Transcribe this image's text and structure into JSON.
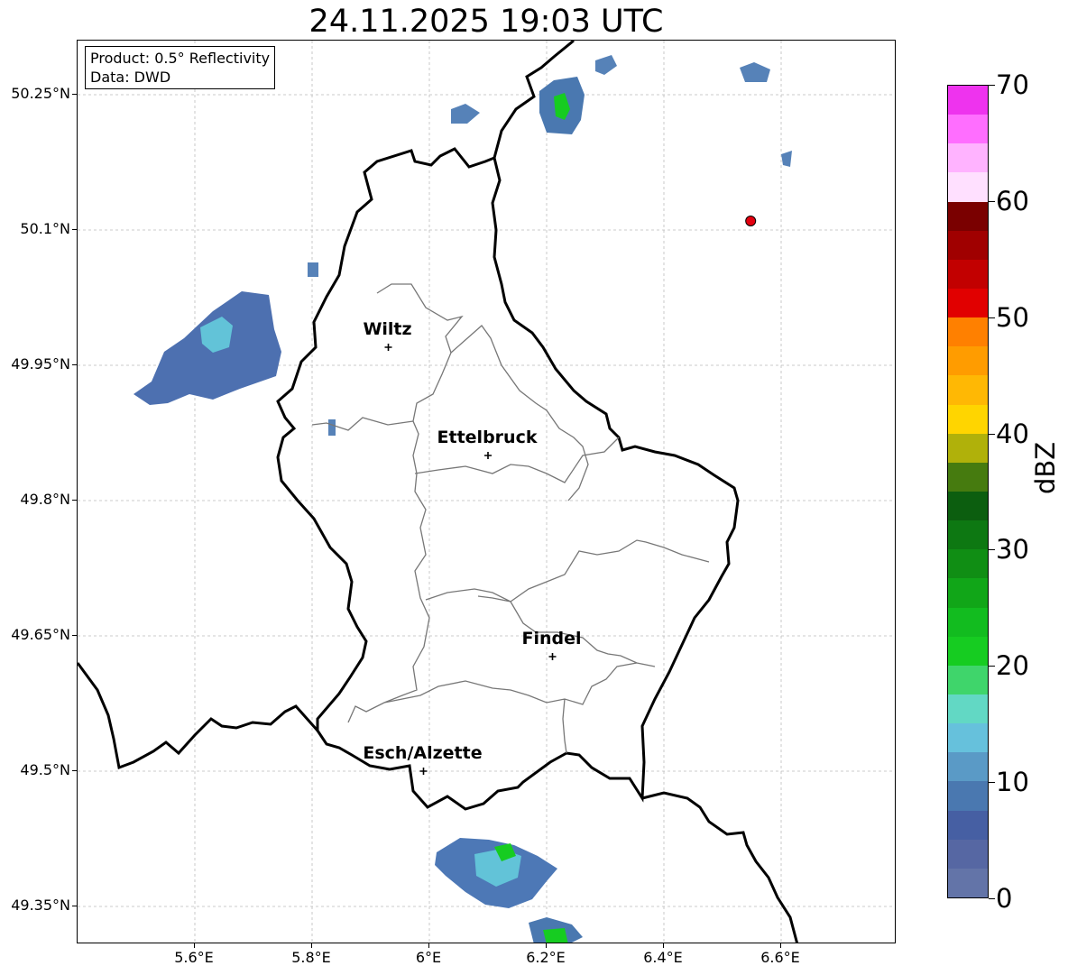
{
  "title": "24.11.2025 19:03 UTC",
  "info": {
    "line1": "Product: 0.5° Reflectivity",
    "line2": "Data: DWD"
  },
  "axes": {
    "lat_labels": [
      "50.25°N",
      "50.1°N",
      "49.95°N",
      "49.8°N",
      "49.65°N",
      "49.5°N",
      "49.35°N"
    ],
    "lon_labels": [
      "5.6°E",
      "5.8°E",
      "6°E",
      "6.2°E",
      "6.4°E",
      "6.6°E"
    ],
    "lon_range": [
      5.4,
      6.8
    ],
    "lat_range": [
      49.3,
      50.3
    ],
    "grid": true
  },
  "cities": [
    {
      "name": "Wiltz",
      "lon": 5.93,
      "lat": 49.97
    },
    {
      "name": "Ettelbruck",
      "lon": 6.1,
      "lat": 49.85
    },
    {
      "name": "Findel",
      "lon": 6.21,
      "lat": 49.627
    },
    {
      "name": "Esch/Alzette",
      "lon": 5.99,
      "lat": 49.5
    }
  ],
  "radar_site": {
    "lon": 6.548,
    "lat": 50.11,
    "color": "#e3000f"
  },
  "colorbar": {
    "label": "dBZ",
    "ticks": [
      "0",
      "10",
      "20",
      "30",
      "40",
      "50",
      "60",
      "70"
    ],
    "range": [
      0,
      70
    ],
    "colors": [
      "#6374a8",
      "#5667a3",
      "#465fa3",
      "#4a78b0",
      "#5a9ac6",
      "#66c1dc",
      "#62d8c4",
      "#3fd56b",
      "#16cc21",
      "#12bc1f",
      "#11a618",
      "#108e14",
      "#0d7812",
      "#0c5e0f",
      "#467b0f",
      "#b0b10a",
      "#ffd500",
      "#ffb804",
      "#ff9c00",
      "#ff8000",
      "#e10000",
      "#c20000",
      "#a00000",
      "#7a0000",
      "#ffe0ff",
      "#ffb3ff",
      "#ff6eff",
      "#ee33ee"
    ]
  }
}
